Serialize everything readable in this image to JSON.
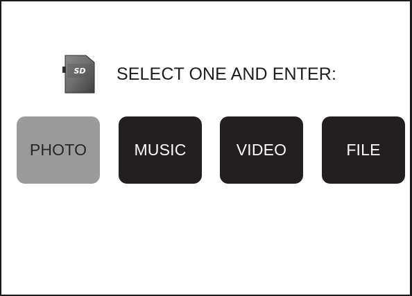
{
  "header": {
    "icon": "sd-card-icon",
    "icon_label": "SD",
    "prompt": "SELECT ONE AND ENTER:"
  },
  "menu": {
    "selected": "PHOTO",
    "items": [
      {
        "label": "PHOTO",
        "selected": true
      },
      {
        "label": "MUSIC",
        "selected": false
      },
      {
        "label": "VIDEO",
        "selected": false
      },
      {
        "label": "FILE",
        "selected": false
      }
    ]
  },
  "colors": {
    "selected_bg": "#9b9b9b",
    "normal_bg": "#231f20",
    "normal_text": "#ffffff",
    "border": "#1a1a1a"
  }
}
